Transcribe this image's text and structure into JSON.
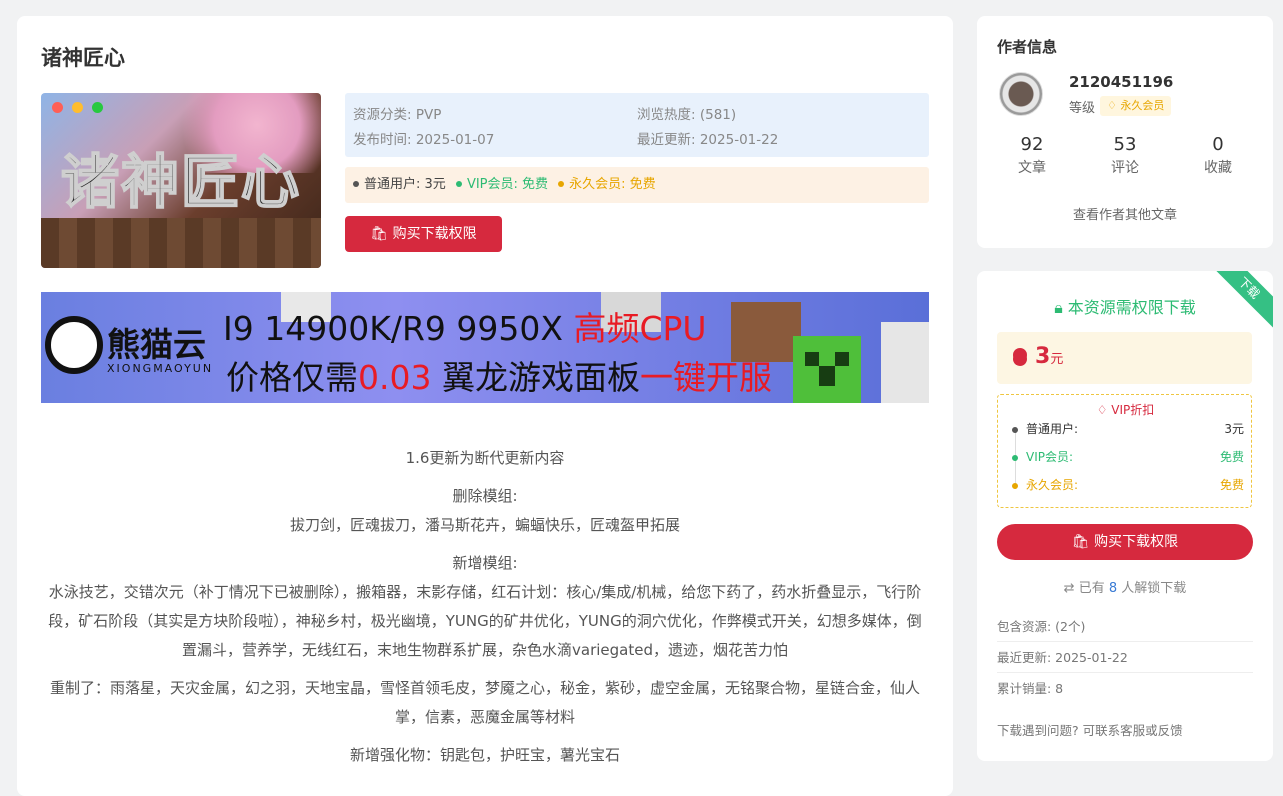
{
  "post": {
    "title": "诸神匠心",
    "thumb_text": "诸神匠心",
    "category": "资源分类: PVP",
    "views": "浏览热度: (581)",
    "published": "发布时间: 2025-01-07",
    "updated": "最近更新: 2025-01-22",
    "price_normal": "普通用户: 3元",
    "price_vip": "VIP会员: 免费",
    "price_perm": "永久会员: 免费",
    "buy_label": "购买下载权限"
  },
  "banner": {
    "logo": "熊猫云",
    "logo_sub": "XIONGMAOYUN",
    "line1_a": "I9 14900K/R9 9950X ",
    "line1_b": "高频CPU",
    "line2_a": "价格仅需",
    "line2_b": "0.03",
    "line2_c": " 翼龙游戏面板",
    "line2_d": "一键开服"
  },
  "article": {
    "p1": "1.6更新为断代更新内容",
    "p2_h": "删除模组:",
    "p2": "拔刀剑，匠魂拔刀，潘马斯花卉，蝙蝠快乐，匠魂盔甲拓展",
    "p3_h": "新增模组:",
    "p3": "水泳技艺，交错次元（补丁情况下已被删除），搬箱器，末影存储，红石计划：核心/集成/机械，给您下药了，药水折叠显示，飞行阶段，矿石阶段（其实是方块阶段啦），神秘乡村，极光幽境，YUNG的矿井优化，YUNG的洞穴优化，作弊模式开关，幻想多媒体，倒置漏斗，营养学，无线红石，末地生物群系扩展，杂色水滴variegated，遗迹，烟花苦力怕",
    "p4": "重制了：雨落星，天灾金属，幻之羽，天地宝晶，雪怪首领毛皮，梦魇之心，秘金，紫砂，虚空金属，无铭聚合物，星链合金，仙人掌，信素，恶魔金属等材料",
    "p5": "新增强化物：钥匙包，护旺宝，薯光宝石"
  },
  "author": {
    "heading": "作者信息",
    "name": "2120451196",
    "level_label": "等级",
    "level_badge": "永久会员",
    "stats": [
      {
        "n": "92",
        "l": "文章"
      },
      {
        "n": "53",
        "l": "评论"
      },
      {
        "n": "0",
        "l": "收藏"
      }
    ],
    "more": "查看作者其他文章"
  },
  "download": {
    "ribbon": "下载",
    "need": "本资源需权限下载",
    "price": "3",
    "unit": "元",
    "vip_title": "VIP折扣",
    "rows": [
      {
        "k": "普通用户:",
        "v": "3元"
      },
      {
        "k": "VIP会员:",
        "v": "免费"
      },
      {
        "k": "永久会员:",
        "v": "免费"
      }
    ],
    "buy_label": "购买下载权限",
    "unlocked_a": "已有",
    "unlocked_n": "8",
    "unlocked_b": "人解锁下载",
    "contains": "包含资源: (2个)",
    "updated": "最近更新: 2025-01-22",
    "sales": "累计销量: 8",
    "help": "下载遇到问题? 可联系客服或反馈"
  },
  "colors": {
    "accent": "#d6293e",
    "green": "#2dbb73",
    "gold": "#e7a600",
    "link": "#3a7bd5"
  }
}
